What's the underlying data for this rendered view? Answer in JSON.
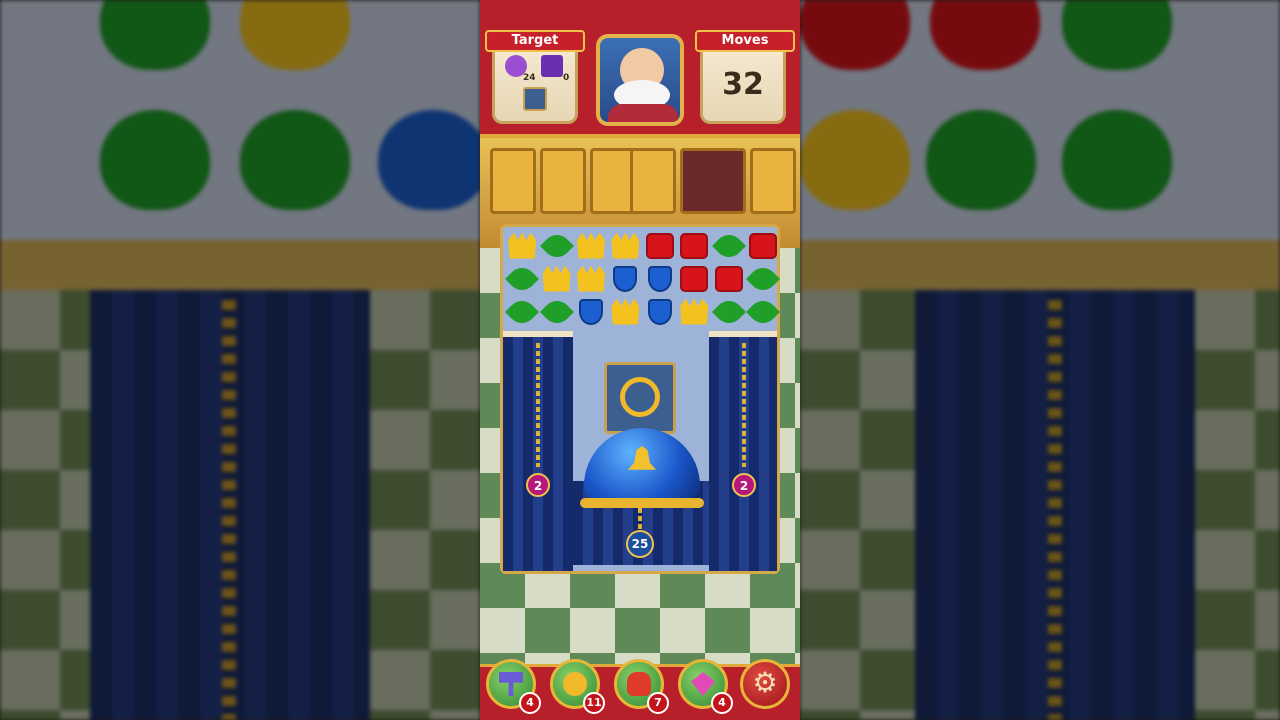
{
  "header": {
    "target_label": "Target",
    "moves_label": "Moves",
    "moves_value": "32",
    "targets": [
      {
        "icon": "purple-flower-icon",
        "count": "24"
      },
      {
        "icon": "purple-block-icon",
        "count": "0"
      },
      {
        "icon": "safe-icon",
        "count": ""
      }
    ]
  },
  "board": {
    "rows": [
      [
        "crown",
        "leaf",
        "crown",
        "crown",
        "block",
        "block",
        "leaf",
        "block"
      ],
      [
        "leaf",
        "crown",
        "crown",
        "shield",
        "shield",
        "block",
        "block",
        "leaf"
      ],
      [
        "leaf",
        "leaf",
        "shield",
        "crown",
        "shield",
        "crown",
        "leaf",
        "leaf"
      ]
    ],
    "counters": {
      "left": "2",
      "right": "2",
      "bell": "25"
    }
  },
  "boosters": [
    {
      "icon": "hammer-icon",
      "count": "4"
    },
    {
      "icon": "balloon-icon",
      "count": "11"
    },
    {
      "icon": "rocket-icon",
      "count": "7"
    },
    {
      "icon": "gem-bomb-icon",
      "count": "4"
    }
  ],
  "colors": {
    "bar_red": "#b7202a",
    "gold": "#e0a93a",
    "crown": "#f4c21e",
    "leaf": "#1f9e28",
    "block": "#d7141b",
    "shield": "#1b5fd0"
  }
}
